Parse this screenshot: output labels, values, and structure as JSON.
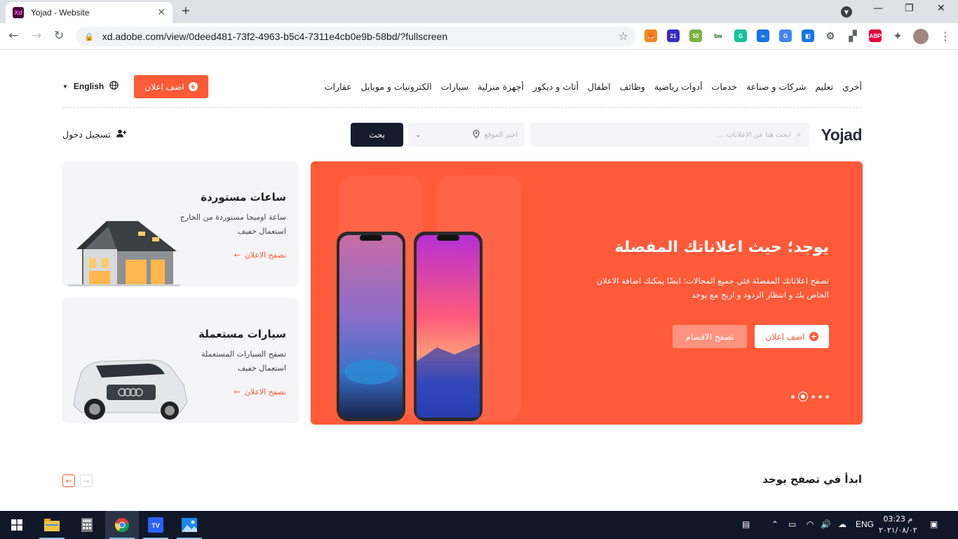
{
  "browser": {
    "tab_title": "Yojad - Website",
    "tab_icon_label": "Xd",
    "url": "xd.adobe.com/view/0deed481-73f2-4963-b5c4-7311e4cb0e9b-58bd/?fullscreen",
    "extensions": [
      {
        "name": "metamask-icon",
        "label": "🦊",
        "color": "#f6851b"
      },
      {
        "name": "extension-21-icon",
        "label": "21",
        "color": "#3b2cc2"
      },
      {
        "name": "extension-50-icon",
        "label": "50",
        "color": "#7cb342"
      },
      {
        "name": "bw-icon",
        "label": "bw",
        "color": "#ffffff"
      },
      {
        "name": "grammarly-icon",
        "label": "G",
        "color": "#15c39a"
      },
      {
        "name": "loop-icon",
        "label": "∞",
        "color": "#1a73e8"
      },
      {
        "name": "translate-icon",
        "label": "G",
        "color": "#4285f4"
      },
      {
        "name": "extension-box-icon",
        "label": "◧",
        "color": "#1a73e8"
      },
      {
        "name": "settings-ext-icon",
        "label": "⚙",
        "color": "#5f6368"
      },
      {
        "name": "bookmark-ext-icon",
        "label": "▞",
        "color": "#5f6368"
      },
      {
        "name": "adblock-icon",
        "label": "ABP",
        "color": "#e5003c"
      },
      {
        "name": "puzzle-icon",
        "label": "✦",
        "color": "#5f6368"
      }
    ]
  },
  "nav": {
    "links": [
      "عقارات",
      "الكترونيات و موبايل",
      "سيارات",
      "أجهزة منزلية",
      "أثاث و ديكور",
      "اطفال",
      "وظائف",
      "أدوات رياضية",
      "خدمات",
      "شركات و صناعة",
      "تعليم",
      "أخري"
    ],
    "post_ad": "اضف اعلان",
    "language": "English"
  },
  "search": {
    "logo": "Yojad",
    "placeholder": "ابحث هنا عن الاعلانات ...",
    "location_placeholder": "اختر الموقع",
    "button": "بحث",
    "login": "تسجيل دخول"
  },
  "hero": {
    "title": "يوجد؛ حيث اعلاناتك المفضلة",
    "description": "تصفح اعلاناتك المفضلة فئي جميع المجالات؛ ايضًا يمكنك اضافة الاعلان الخاص بك و انتظار الردود و اربح مع يوجد",
    "primary_button": "اضف اعلان",
    "secondary_button": "تصفح الاقسام",
    "slides_count": 4,
    "active_slide": 2
  },
  "cards": [
    {
      "title": "ساعات مستوردة",
      "desc_line1": "ساعة اوميجا مستوردة من الخارج",
      "desc_line2": "استعمال خفيف",
      "link": "تصفح الاعلان"
    },
    {
      "title": "سيارات مستعملة",
      "desc_line1": "تصفح السيارات المستعملة",
      "desc_line2": "استعمال خفيف",
      "link": "تصفح الاعلان"
    }
  ],
  "section": {
    "title": "ابدأ في تصفح يوجد"
  },
  "taskbar": {
    "lang": "ENG",
    "time": "م 03:23",
    "date": "٢٠٢١/٠٨/٠٢"
  },
  "colors": {
    "accent": "#ff5a36",
    "dark": "#141b2d"
  }
}
